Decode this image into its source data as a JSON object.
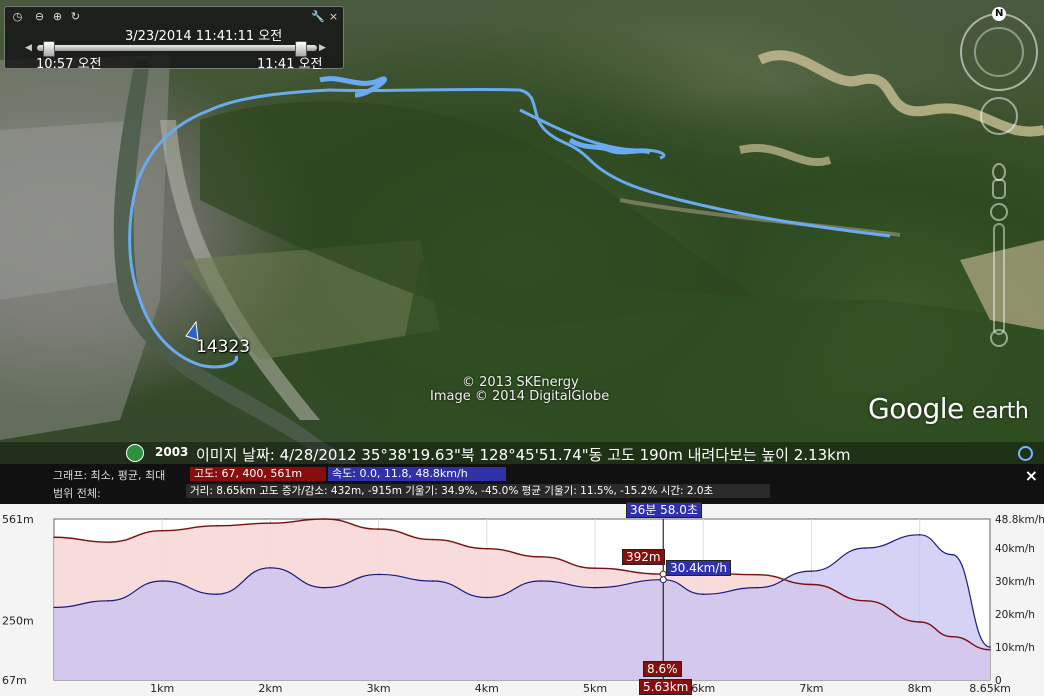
{
  "timebar": {
    "date_time": "3/23/2014  11:41:11 오전",
    "start_time": "10:57 오전",
    "end_time": "11:41 오전"
  },
  "map": {
    "marker_label": "14323",
    "copyright_line1": "© 2013 SKEnergy",
    "copyright_line2": "Image © 2014 DigitalGlobe",
    "brand_google": "Google",
    "brand_earth": "earth",
    "compass_north": "N"
  },
  "status": {
    "year": "2003",
    "text": "이미지 날짜: 4/28/2012    35°38'19.63\"북 128°45'51.74\"동 고도    190m    내려다보는 높이    2.13km"
  },
  "profile": {
    "row1_label": "그래프: 최소, 평균, 최대",
    "elevation_chip": "고도: 67, 400, 561m",
    "speed_chip": "속도: 0.0, 11.8, 48.8km/h",
    "row2_label": "범위 전체:",
    "range_chip": "거리: 8.65km 고도 증가/감소: 432m, -915m 기울기: 34.9%, -45.0% 평균 기울기: 11.5%, -15.2% 시간: 2.0초",
    "cursor_time": "36분 58.0초",
    "cursor_elev": "392m",
    "cursor_speed": "30.4km/h",
    "cursor_slope": "8.6%",
    "cursor_dist": "5.63km",
    "close_label": "×"
  },
  "colors": {
    "track": "#5aa0e6",
    "elevation_line": "#7a1010",
    "elevation_fill": "#f7d7d7",
    "speed_line": "#1a1a80",
    "speed_fill": "#c8c3f2",
    "elev_chip": "#8a0d0d",
    "speed_chip": "#3030a8"
  },
  "chart_data": {
    "type": "area",
    "x_unit": "km",
    "x_range": [
      0,
      8.65
    ],
    "x_ticks": [
      "1km",
      "2km",
      "3km",
      "4km",
      "5km",
      "6km",
      "7km",
      "8km",
      "8.65km"
    ],
    "left_axis_ticks": [
      "561m",
      "250m",
      "67m"
    ],
    "right_axis_ticks": [
      "48.8km/h",
      "40km/h",
      "30km/h",
      "20km/h",
      "10km/h",
      "0"
    ],
    "series": [
      {
        "name": "고도",
        "unit": "m",
        "range": [
          67,
          561
        ],
        "x": [
          0,
          0.5,
          1.0,
          1.5,
          2.0,
          2.5,
          3.0,
          3.5,
          4.0,
          4.5,
          5.0,
          5.63,
          6.0,
          6.5,
          7.0,
          7.5,
          8.0,
          8.3,
          8.65
        ],
        "values": [
          505,
          490,
          525,
          540,
          548,
          561,
          530,
          498,
          470,
          445,
          410,
          392,
          395,
          390,
          360,
          310,
          245,
          200,
          160
        ]
      },
      {
        "name": "속도",
        "unit": "km/h",
        "range": [
          0,
          48.8
        ],
        "x": [
          0,
          0.5,
          1.0,
          1.5,
          2.0,
          2.5,
          3.0,
          3.5,
          4.0,
          4.5,
          5.0,
          5.63,
          6.0,
          6.5,
          7.0,
          7.5,
          8.0,
          8.3,
          8.65
        ],
        "values": [
          22,
          24,
          30,
          26,
          34,
          28,
          32,
          30,
          25,
          30,
          28,
          30.4,
          26,
          28,
          33,
          40,
          44,
          38,
          10
        ]
      }
    ],
    "cursor": {
      "x": 5.63,
      "elevation": 392,
      "speed": 30.4,
      "slope": "8.6%",
      "time": "36분 58.0초"
    }
  }
}
